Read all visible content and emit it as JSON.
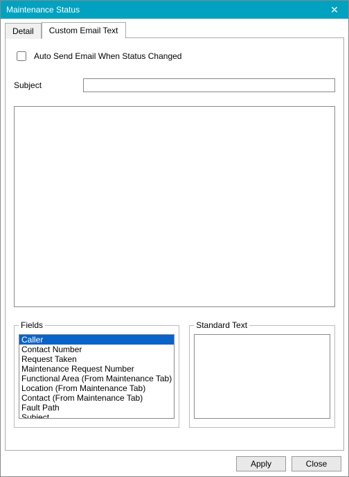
{
  "window": {
    "title": "Maintenance Status",
    "close_glyph": "✕"
  },
  "tabs": {
    "detail": "Detail",
    "custom_email": "Custom Email Text",
    "active": "custom_email"
  },
  "form": {
    "auto_send_label": "Auto Send Email When Status Changed",
    "auto_send_checked": false,
    "subject_label": "Subject",
    "subject_value": "",
    "body_value": ""
  },
  "fields_group": {
    "legend": "Fields",
    "items": [
      "Caller",
      "Contact Number",
      "Request Taken",
      "Maintenance Request Number",
      "Functional Area (From Maintenance Tab)",
      "Location (From Maintenance Tab)",
      "Contact (From Maintenance Tab)",
      "Fault Path",
      "Subject"
    ],
    "selected_index": 0
  },
  "standard_text_group": {
    "legend": "Standard Text",
    "value": ""
  },
  "buttons": {
    "apply": "Apply",
    "close": "Close"
  }
}
